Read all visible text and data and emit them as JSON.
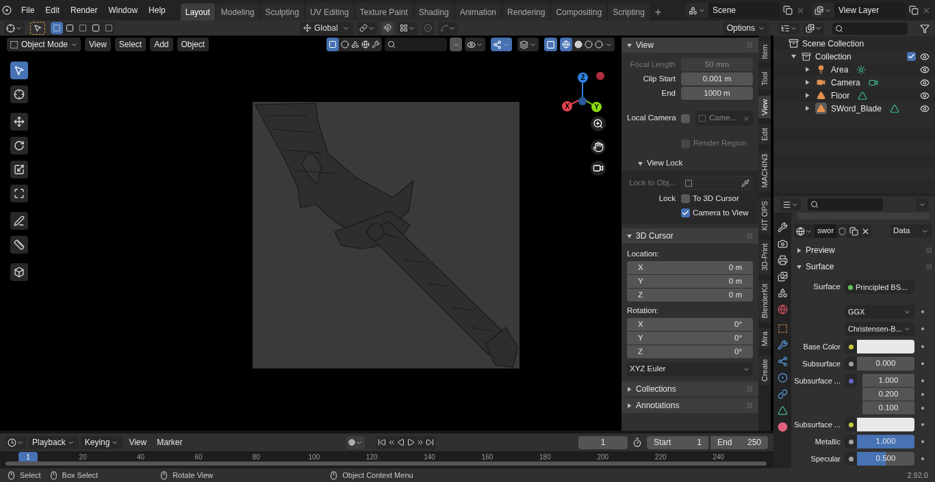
{
  "menu": [
    "File",
    "Edit",
    "Render",
    "Window",
    "Help"
  ],
  "workspaces": [
    {
      "label": "Layout",
      "selected": true
    },
    {
      "label": "Modeling",
      "selected": false
    },
    {
      "label": "Sculpting",
      "selected": false
    },
    {
      "label": "UV Editing",
      "selected": false
    },
    {
      "label": "Texture Paint",
      "selected": false
    },
    {
      "label": "Shading",
      "selected": false
    },
    {
      "label": "Animation",
      "selected": false
    },
    {
      "label": "Rendering",
      "selected": false
    },
    {
      "label": "Compositing",
      "selected": false
    },
    {
      "label": "Scripting",
      "selected": false
    }
  ],
  "add_workspace": "+",
  "scene": "Scene",
  "view_layer": "View Layer",
  "tool_header": {
    "orientation": "Global",
    "options": "Options"
  },
  "viewport": {
    "mode": "Object Mode",
    "menus": [
      "View",
      "Select",
      "Add",
      "Object"
    ],
    "toggles": [
      {
        "kind": "gizmo",
        "on": true
      },
      {
        "kind": "overlay",
        "on": false
      },
      {
        "kind": "xray",
        "on": true
      }
    ],
    "gizmo_axes": [
      {
        "label": "X",
        "color": "#e5434f"
      },
      {
        "label": "Y",
        "color": "#8bdc0f"
      },
      {
        "label": "Z",
        "color": "#2f83e3"
      }
    ]
  },
  "toolbar": [
    {
      "tools": [
        {
          "kind": "select",
          "selected": true
        },
        {
          "kind": "cursor",
          "selected": false
        }
      ]
    },
    {
      "tools": [
        {
          "kind": "move",
          "selected": false
        },
        {
          "kind": "rotate",
          "selected": false
        },
        {
          "kind": "scale",
          "selected": false
        },
        {
          "kind": "transform",
          "selected": false
        }
      ]
    },
    {
      "tools": [
        {
          "kind": "annotate",
          "selected": false
        },
        {
          "kind": "measure",
          "selected": false
        }
      ]
    },
    {
      "tools": [
        {
          "kind": "add_cube",
          "selected": false
        }
      ]
    }
  ],
  "sidebar": {
    "tabs": [
      {
        "label": "Item",
        "selected": false
      },
      {
        "label": "Tool",
        "selected": false
      },
      {
        "label": "View",
        "selected": true
      },
      {
        "label": "Edit",
        "selected": false
      },
      {
        "label": "MACHIN3",
        "selected": false
      },
      {
        "label": "KIT OPS",
        "selected": false
      },
      {
        "label": "3D-Print",
        "selected": false
      },
      {
        "label": "BlenderKit",
        "selected": false
      },
      {
        "label": "Mira",
        "selected": false
      },
      {
        "label": "Create",
        "selected": false
      }
    ],
    "view_panel": {
      "title": "View",
      "expanded": true,
      "fields": [
        {
          "label": "Focal Length",
          "value": "50 mm",
          "disabled": true
        },
        {
          "label": "Clip Start",
          "value": "0.001 m",
          "disabled": false
        },
        {
          "label": "End",
          "value": "1000 m",
          "disabled": false
        }
      ],
      "local_camera": {
        "label": "Local Camera",
        "checked": false,
        "camera": "Came..."
      },
      "render_region": {
        "label": "Render Region",
        "checked": false,
        "disabled": true
      }
    },
    "view_lock": {
      "title": "View Lock",
      "expanded": true,
      "lock_to_object": "Lock to Obj...",
      "lock_label": "Lock",
      "options": [
        {
          "label": "To 3D Cursor",
          "checked": false
        },
        {
          "label": "Camera to View",
          "checked": true
        }
      ]
    },
    "cursor": {
      "title": "3D Cursor",
      "expanded": true,
      "location_label": "Location:",
      "location": [
        {
          "axis": "X",
          "value": "0 m"
        },
        {
          "axis": "Y",
          "value": "0 m"
        },
        {
          "axis": "Z",
          "value": "0 m"
        }
      ],
      "rotation_label": "Rotation:",
      "rotation": [
        {
          "axis": "X",
          "value": "0°"
        },
        {
          "axis": "Y",
          "value": "0°"
        },
        {
          "axis": "Z",
          "value": "0°"
        }
      ],
      "rotation_mode": "XYZ Euler"
    },
    "collapsed_panels": [
      {
        "title": "Collections",
        "expanded": false
      },
      {
        "title": "Annotations",
        "expanded": false
      }
    ]
  },
  "outliner": {
    "root": "Scene Collection",
    "children": [
      {
        "name": "Collection",
        "expanded": true,
        "checked": true,
        "children": [
          {
            "name": "Area",
            "kind": "light",
            "expanded": false,
            "selected": false
          },
          {
            "name": "Camera",
            "kind": "camera",
            "expanded": false,
            "selected": false
          },
          {
            "name": "Floor",
            "kind": "mesh",
            "expanded": false,
            "selected": false
          },
          {
            "name": "SWord_Blade",
            "kind": "mesh",
            "expanded": false,
            "selected": true
          }
        ]
      }
    ]
  },
  "properties": {
    "material": "swor",
    "link": "Data",
    "panels": [
      {
        "title": "Preview",
        "expanded": false
      },
      {
        "title": "Surface",
        "expanded": true
      }
    ],
    "surface_label": "Surface",
    "shader": "Principled BS...",
    "distribution": "GGX",
    "subsurface_method": "Christensen-B...",
    "inputs": [
      {
        "label": "Base Color",
        "kind": "color",
        "color": "#c8c83c"
      },
      {
        "label": "Subsurface",
        "kind": "value",
        "color": "#a1a1a1",
        "value": "0.000"
      },
      {
        "label": "Subsurface ...",
        "kind": "vector",
        "color": "#6363c7",
        "values": [
          "1.000",
          "0.200",
          "0.100"
        ]
      },
      {
        "label": "Subsurface ...",
        "kind": "color",
        "color": "#c8c83c"
      },
      {
        "label": "Metallic",
        "kind": "value",
        "color": "#a1a1a1",
        "value": "1.000",
        "level": 1
      },
      {
        "label": "Specular",
        "kind": "value",
        "color": "#a1a1a1",
        "value": "0.500",
        "level": 0.5
      }
    ]
  },
  "timeline": {
    "menus": [
      {
        "label": "Playback",
        "dropdown": true
      },
      {
        "label": "Keying",
        "dropdown": true
      },
      {
        "label": "View",
        "dropdown": false
      },
      {
        "label": "Marker",
        "dropdown": false
      }
    ],
    "current_frame": "1",
    "start_label": "Start",
    "start": "1",
    "end_label": "End",
    "end": "250",
    "ticks": [
      {
        "label": "1",
        "selected": true
      },
      {
        "label": "20",
        "selected": false
      },
      {
        "label": "40",
        "selected": false
      },
      {
        "label": "60",
        "selected": false
      },
      {
        "label": "80",
        "selected": false
      },
      {
        "label": "100",
        "selected": false
      },
      {
        "label": "120",
        "selected": false
      },
      {
        "label": "140",
        "selected": false
      },
      {
        "label": "160",
        "selected": false
      },
      {
        "label": "180",
        "selected": false
      },
      {
        "label": "200",
        "selected": false
      },
      {
        "label": "220",
        "selected": false
      },
      {
        "label": "240",
        "selected": false
      }
    ]
  },
  "status": {
    "hints": [
      "Select",
      "Box Select",
      "Rotate View",
      "Object Context Menu"
    ],
    "version": "2.92.0"
  }
}
